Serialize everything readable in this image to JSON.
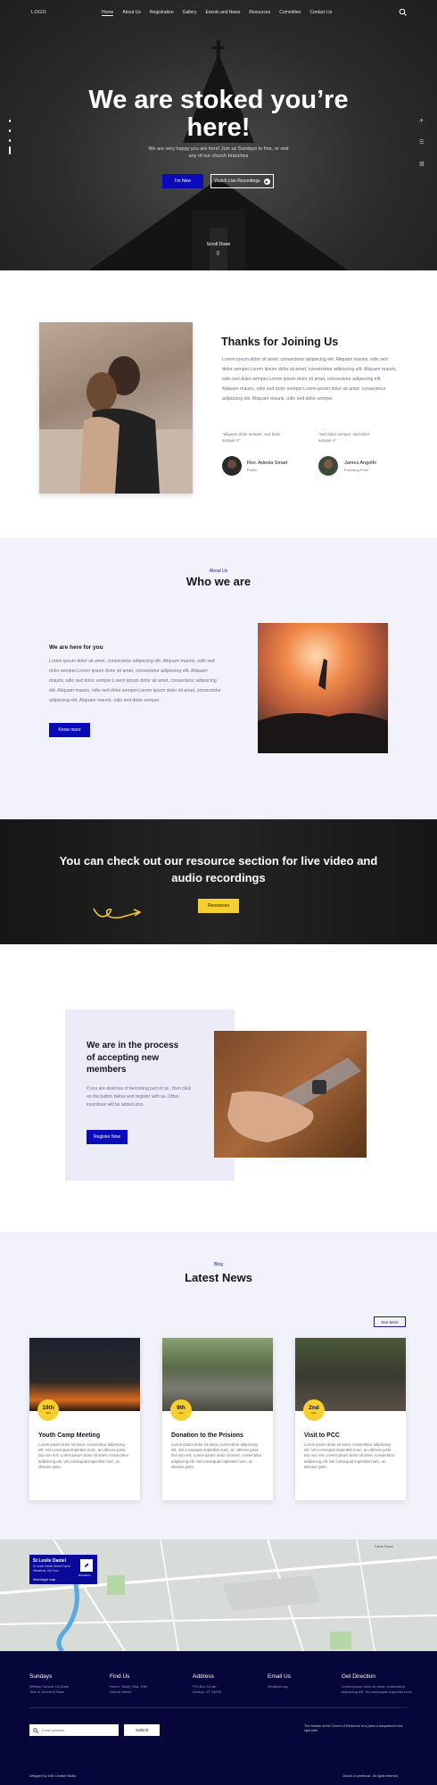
{
  "nav": {
    "logo": "LOGO",
    "items": [
      "Home",
      "About Us",
      "Registration",
      "Gallery",
      "Events and News",
      "Resources",
      "Committee",
      "Contact Us"
    ]
  },
  "hero": {
    "title_line1": "We are stoked you’re",
    "title_line2": "here!",
    "subtitle_line1": "We are very happy you are here! Join us Sundays to fine, or visit",
    "subtitle_line2": "any of our church branches",
    "btn_new": "I'm New",
    "btn_watch": "Watch Live Recordings",
    "scroll": "Scroll Down"
  },
  "thanks": {
    "title": "Thanks for Joining Us",
    "body": "Lorem ipsum dolor sit amet, consectetur adipiscing elit. Aliquam mauris, odio sed dolor semper.Lorem ipsum dolor sit amet, consectetur adipiscing elit. Aliquam mauris, odio sed dolor semper.Lorem ipsum dolor sit amet, consectetur adipiscing elit. Aliquam mauris, odio sed dolor semper.Lorem ipsum dolor sit amet, consectetur adipiscing elit. Aliquam mauris, odio sed dolor semper.",
    "people": [
      {
        "quote": "\"aliquam dolor semper, sed dolor semper s\"",
        "name": "Rev. Adeola Smart",
        "role": "Pastor"
      },
      {
        "quote": "\"sed dolor semper, sed dolor semper s\"",
        "name": "James Angolfo",
        "role": "Founding Pride"
      }
    ]
  },
  "who": {
    "eyebrow": "About Us",
    "title": "Who we are",
    "sub": "We are here for you",
    "body": "Lorem ipsum dolor sit amet, consectetur adipiscing elit. Aliquam mauris, odio sed dolor semper.Lorem ipsum dolor sit amet, consectetur adipiscing elit. Aliquam mauris, odio sed dolor semper.Lorem ipsum dolor sit amet, consectetur adipiscing elit. Aliquam mauris, odio sed dolor semper.Lorem ipsum dolor sit amet, consectetur adipiscing elit. Aliquam mauris, odio sed dolor semper.",
    "btn": "Know more"
  },
  "resources": {
    "line1": "You can check out our resource section for live video and",
    "line2": "audio recordings",
    "btn": "Resources"
  },
  "process": {
    "title_l1": "We are in the process",
    "title_l2": "of accepting new",
    "title_l3": "members",
    "body": "If you are desirous of becoming part of us , then click on the button below and register with us. Other incentives will be added also.",
    "btn": "Register Now"
  },
  "blog": {
    "eyebrow": "Blog",
    "title": "Latest News",
    "see_more": "See More",
    "posts": [
      {
        "day": "19th",
        "mon": "Nov",
        "title": "Youth Camp Meeting",
        "body": "Lorem ipsum dolor sit amet, consectetur adipiscing elit. Vel consequat imperdiet nunc, ac ultricies justo. Dui non nisl. Lorem ipsum dolor sit amet, consectetur adipiscing elit. Vel consequat imperdiet nunc, ac ultricies justo."
      },
      {
        "day": "9th",
        "mon": "Nov",
        "title": "Donation to the Prisions",
        "body": "Lorem ipsum dolor sit amet, consectetur adipiscing elit. Vel consequat imperdiet nunc, ac ultricies justo. Dui non nisl. Lorem ipsum dolor sit amet, consectetur adipiscing elit. Vel consequat imperdiet nunc, ac ultricies justo."
      },
      {
        "day": "2nd",
        "mon": "Nov",
        "title": "Visit to PCC",
        "body": "Lorem ipsum dolor sit amet, consectetur adipiscing elit. Vel consequat imperdiet nunc, ac ultricies justo. Dui non nisl. Lorem ipsum dolor sit amet, consectetur adipiscing elit. Vel consequat imperdiet nunc, ac ultricies justo."
      }
    ]
  },
  "map": {
    "card_title": "St Leslie Daniel",
    "card_addr": "St Leslie Daniel Street Robert Wheathall, 6th Floor",
    "card_link": "View larger map",
    "dir": "Directions",
    "road": "Davis Road"
  },
  "footer": {
    "cols": [
      {
        "h": "Sundays",
        "l1": "Weekly Service 10:30am",
        "l2": "Tech & Sound 8:30am"
      },
      {
        "h": "Find Us",
        "l1": "Home, Teddy Villa, 19th",
        "l2": "Oxford Street"
      },
      {
        "h": "Address",
        "l1": "P.O.Box 16 lan",
        "l2": "Dunlop, VT 23232"
      },
      {
        "h": "Email Us",
        "l1": "info@cst.org",
        "l2": ""
      },
      {
        "h": "Get Direction",
        "l1": "Lorem ipsum dolor sit amet, consectetur",
        "l2": "adipiscing elit. Vel consequat imperdiet nunc."
      }
    ],
    "email_placeholder": "Email address",
    "submit": "Submit",
    "note": "The mission of the Church of Pentecost is to place a lampstand in the right path",
    "credit": "Designed by 10th Creative Studio",
    "rights": "Church of pentecost . All rights reserved."
  }
}
